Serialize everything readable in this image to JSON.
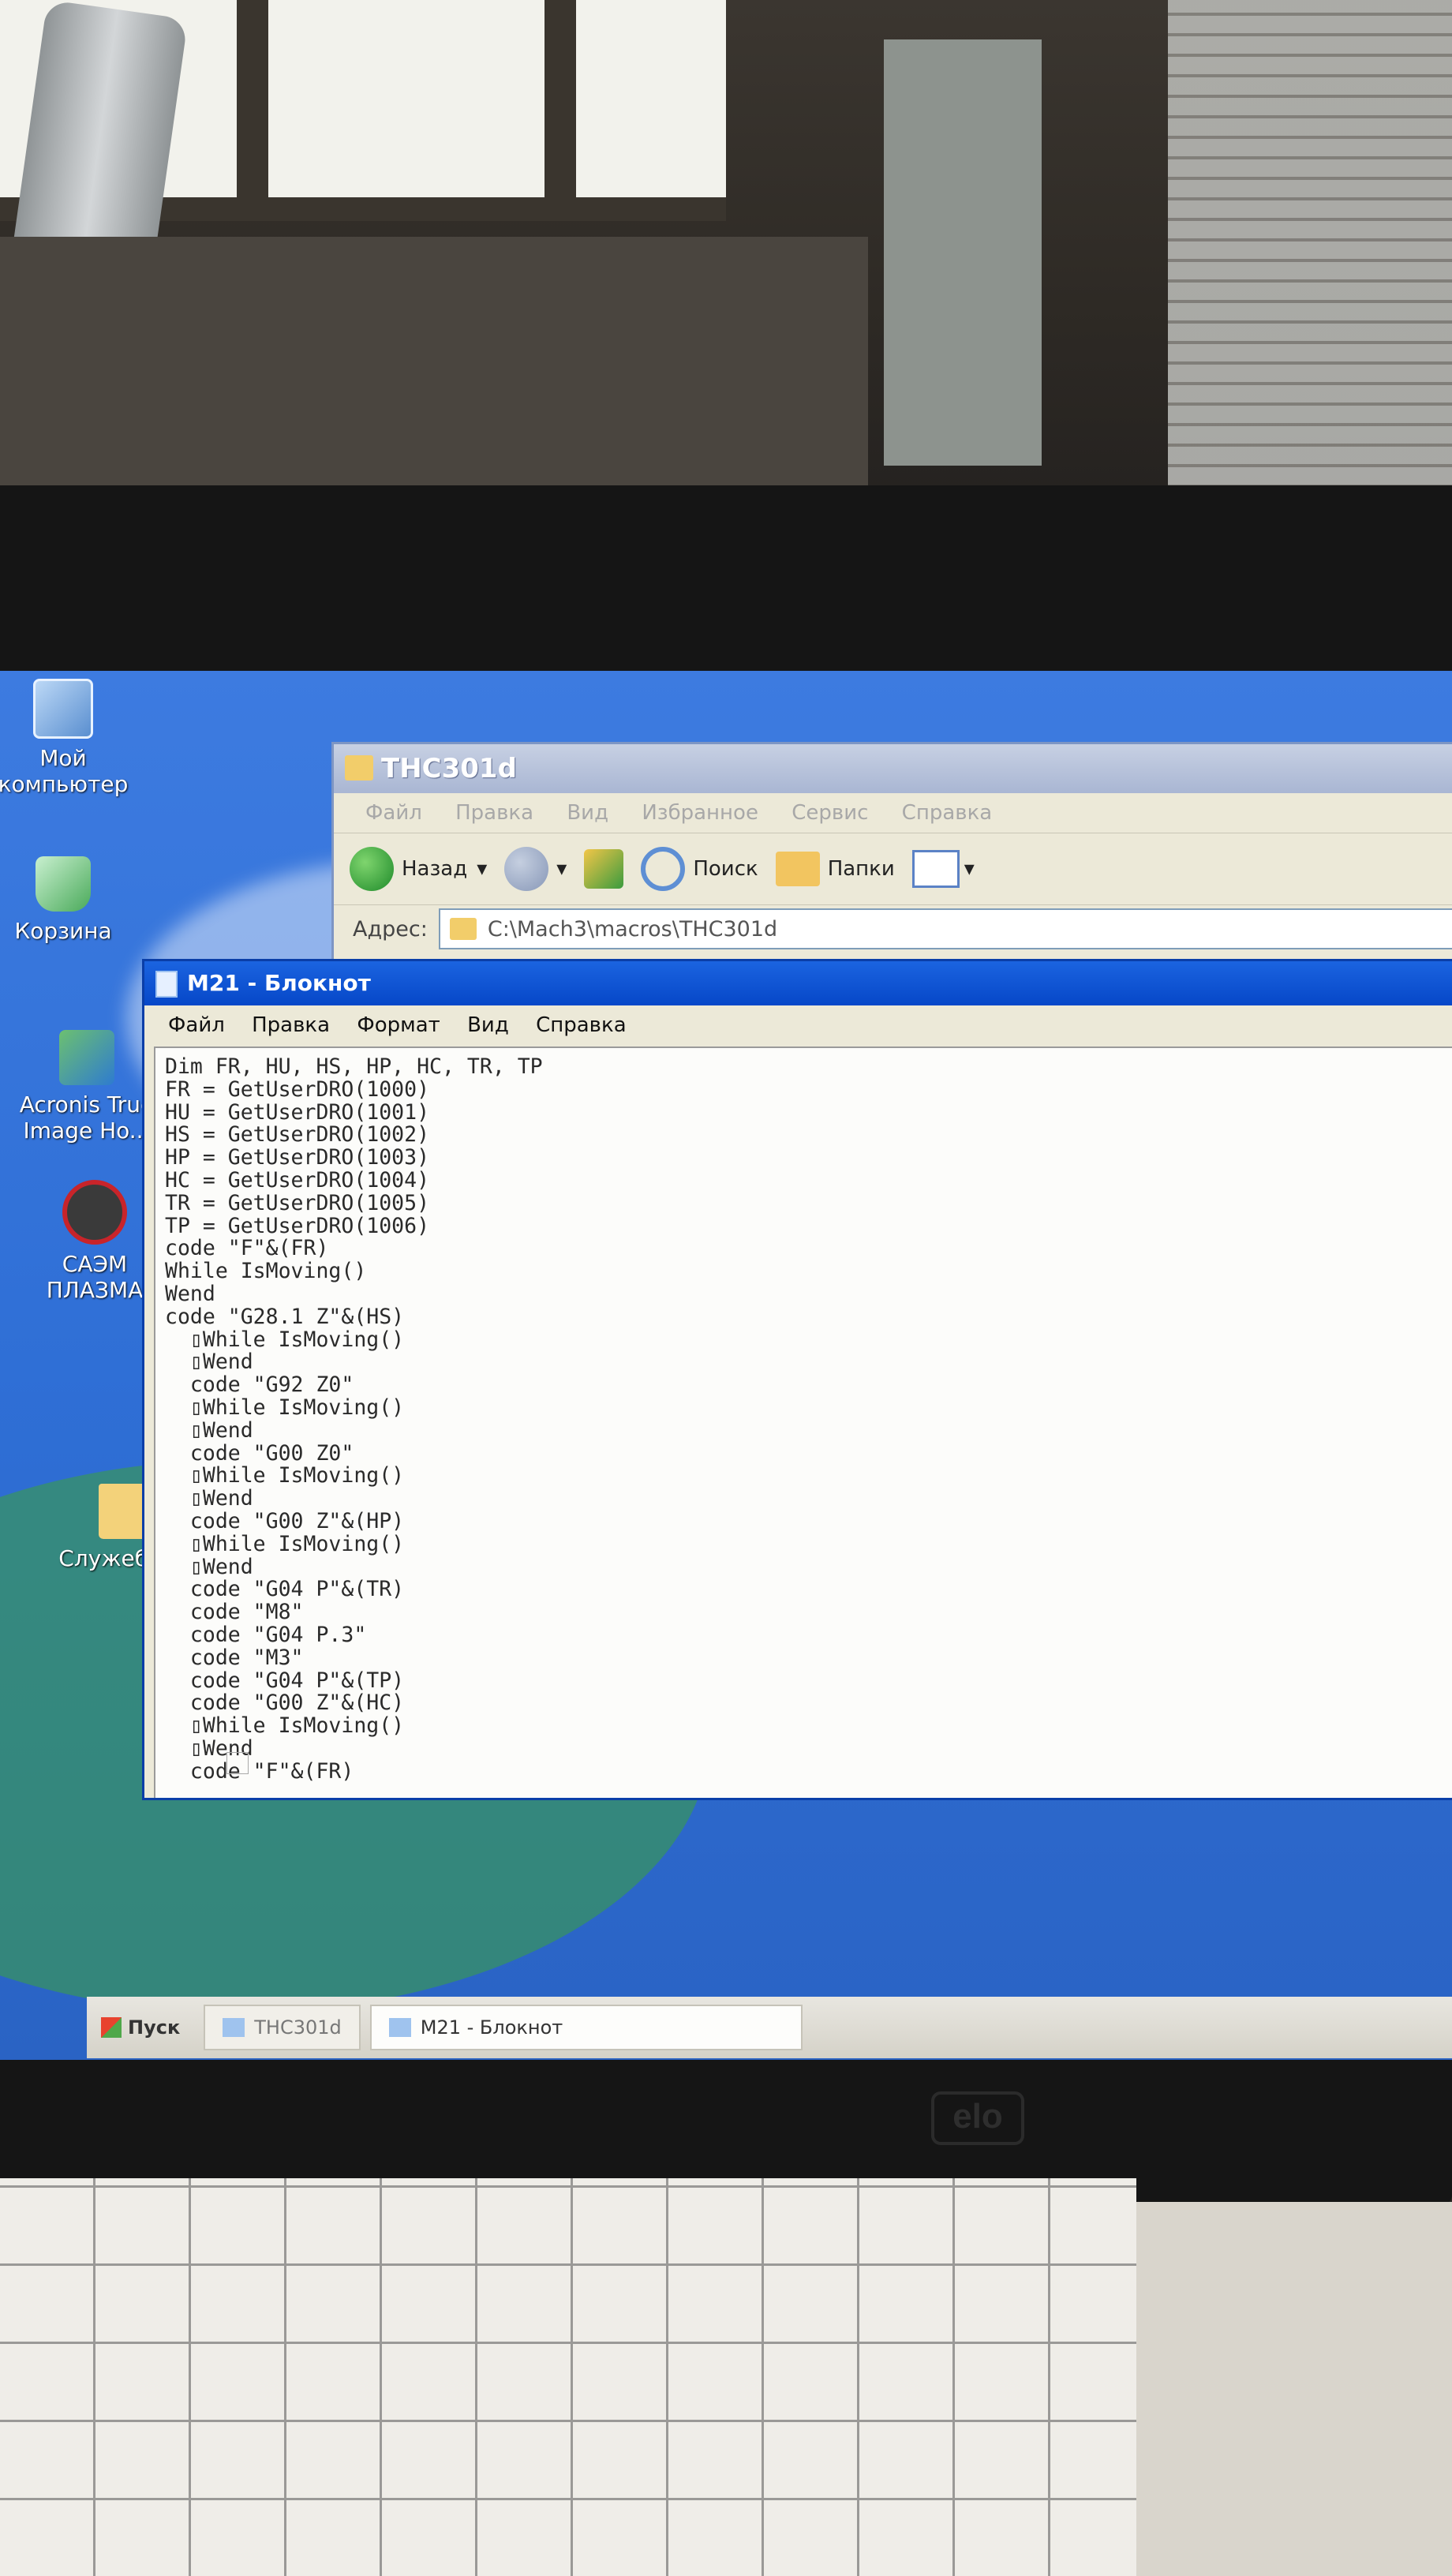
{
  "desktop": {
    "icons": [
      {
        "label": "Мой компьютер",
        "icon": "my-computer-icon"
      },
      {
        "label": "Корзина",
        "icon": "recycle-bin-icon"
      },
      {
        "label": "Acronis True Image Ho...",
        "icon": "acronis-icon"
      },
      {
        "label": "САЭМ ПЛАЗМА",
        "icon": "plasma-app-icon"
      },
      {
        "label": "Служебные",
        "icon": "folder-icon"
      }
    ]
  },
  "explorer": {
    "title": "THC301d",
    "menu": [
      "Файл",
      "Правка",
      "Вид",
      "Избранное",
      "Сервис",
      "Справка"
    ],
    "toolbar": {
      "back": "Назад",
      "search": "Поиск",
      "folders": "Папки"
    },
    "address_label": "Адрес:",
    "address_value": "C:\\Mach3\\macros\\THC301d"
  },
  "notepad": {
    "title": "M21 - Блокнот",
    "menu": [
      "Файл",
      "Правка",
      "Формат",
      "Вид",
      "Справка"
    ],
    "lines": [
      "Dim FR, HU, HS, HP, HC, TR, TP",
      "FR = GetUserDRO(1000)",
      "HU = GetUserDRO(1001)",
      "HS = GetUserDRO(1002)",
      "HP = GetUserDRO(1003)",
      "HC = GetUserDRO(1004)",
      "TR = GetUserDRO(1005)",
      "TP = GetUserDRO(1006)",
      "code \"F\"&(FR)",
      "While IsMoving()",
      "Wend",
      "code \"G28.1 Z\"&(HS)",
      "  ▯While IsMoving()",
      "  ▯Wend",
      "  code \"G92 Z0\"",
      "  ▯While IsMoving()",
      "  ▯Wend",
      "  code \"G00 Z0\"",
      "  ▯While IsMoving()",
      "  ▯Wend",
      "  code \"G00 Z\"&(HP)",
      "  ▯While IsMoving()",
      "  ▯Wend",
      "  code \"G04 P\"&(TR)",
      "  code \"M8\"",
      "  code \"G04 P.3\"",
      "  code \"M3\"",
      "  code \"G04 P\"&(TP)",
      "  code \"G00 Z\"&(HC)",
      "  ▯While IsMoving()",
      "  ▯Wend",
      "  code \"F\"&(FR)"
    ]
  },
  "taskbar": {
    "start": "Пуск",
    "tasks": [
      "THC301d",
      "M21 - Блокнот"
    ]
  },
  "monitor_brand": "elo"
}
